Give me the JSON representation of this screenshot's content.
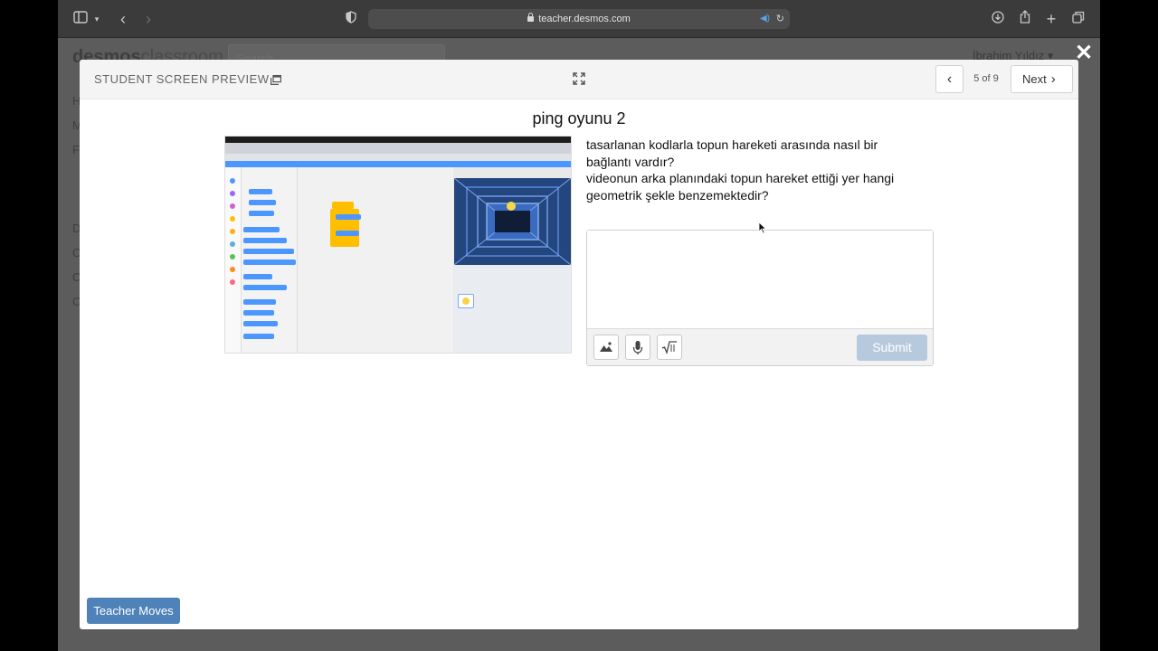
{
  "browser": {
    "url": "teacher.desmos.com"
  },
  "background_page": {
    "logo_bold": "desmos",
    "logo_light": "classroom",
    "search_placeholder": "Search",
    "user_name": "İbrahim Yıldız",
    "sidebar_letters": [
      "H",
      "M",
      "F",
      "D",
      "C",
      "C",
      "C"
    ]
  },
  "modal": {
    "header_title": "STUDENT SCREEN PREVIEW",
    "page_count": "5 of 9",
    "next_label": "Next",
    "screen_title": "ping oyunu 2",
    "question_line1": "tasarlanan kodlarla topun hareketi arasında nasıl bir bağlantı vardır?",
    "question_line2": "videonun arka planındaki topun hareket ettiği yer hangi geometrik şekle benzemektedir?",
    "answer_value": "",
    "submit_label": "Submit",
    "teacher_moves_label": "Teacher Moves"
  },
  "colors": {
    "primary_blue": "#4f82b8",
    "submit_disabled": "#b7c9dd",
    "stage_blue": "#2d4e8a",
    "scratch_blue": "#4c97ff",
    "scratch_yellow": "#ffbf00"
  },
  "icons": [
    "sidebar-icon",
    "back-icon",
    "forward-icon",
    "shield-icon",
    "lock-icon",
    "speaker-icon",
    "reload-icon",
    "download-icon",
    "share-icon",
    "new-tab-icon",
    "tabs-icon",
    "close-icon",
    "popout-icon",
    "fullscreen-icon",
    "chevron-left-icon",
    "chevron-right-icon",
    "image-icon",
    "microphone-icon",
    "math-icon",
    "cursor-icon"
  ]
}
